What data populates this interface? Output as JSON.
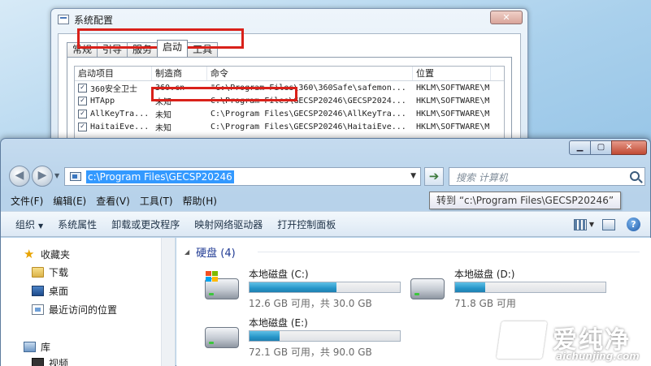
{
  "msconfig": {
    "title": "系统配置",
    "close_label": "✕",
    "tabs": [
      "常规",
      "引导",
      "服务",
      "启动",
      "工具"
    ],
    "active_tab": "启动",
    "columns": [
      "启动项目",
      "制造商",
      "命令",
      "位置"
    ],
    "rows": [
      {
        "checked": true,
        "item": "360安全卫士",
        "maker": "360.cn",
        "command": "\"C:\\Program Files\\360\\360Safe\\safemon...",
        "location": "HKLM\\SOFTWARE\\M"
      },
      {
        "checked": true,
        "item": "HTApp",
        "maker": "未知",
        "command": "C:\\Program Files\\GECSP20246\\GECSP2024...",
        "location": "HKLM\\SOFTWARE\\M"
      },
      {
        "checked": true,
        "item": "AllKeyTra...",
        "maker": "未知",
        "command": "C:\\Program Files\\GECSP20246\\AllKeyTra...",
        "location": "HKLM\\SOFTWARE\\M"
      },
      {
        "checked": true,
        "item": "HaitaiEve...",
        "maker": "未知",
        "command": "C:\\Program Files\\GECSP20246\\HaitaiEve...",
        "location": "HKLM\\SOFTWARE\\M"
      }
    ]
  },
  "explorer": {
    "window_buttons": {
      "minimize": "▁",
      "maximize": "▢",
      "close": "✕"
    },
    "address": "c:\\Program Files\\GECSP20246",
    "search_placeholder": "搜索 计算机",
    "menu": [
      "文件(F)",
      "编辑(E)",
      "查看(V)",
      "工具(T)",
      "帮助(H)"
    ],
    "tooltip": "转到 “c:\\Program Files\\GECSP20246”",
    "commands": [
      "组织",
      "系统属性",
      "卸载或更改程序",
      "映射网络驱动器",
      "打开控制面板"
    ],
    "help_label": "?",
    "nav": {
      "favorites": "收藏夹",
      "downloads": "下载",
      "desktop": "桌面",
      "recent": "最近访问的位置",
      "libraries": "库",
      "videos": "视频"
    },
    "group_title": "硬盘 (4)",
    "drives": [
      {
        "name": "本地磁盘 (C:)",
        "space": "12.6 GB 可用，共 30.0 GB",
        "used_fraction": 0.58,
        "system": true
      },
      {
        "name": "本地磁盘 (D:)",
        "space": "71.8 GB 可用",
        "used_fraction": 0.2,
        "system": false
      },
      {
        "name": "本地磁盘 (E:)",
        "space": "72.1 GB 可用，共 90.0 GB",
        "used_fraction": 0.2,
        "system": false
      }
    ]
  },
  "watermark": {
    "brand": "爱纯净",
    "url": "aichunjing.com"
  },
  "colors": {
    "highlight_box": "#d9211a",
    "selection": "#3399ff",
    "drive_fill": "#2796c9",
    "group_title": "#1f3a93"
  }
}
